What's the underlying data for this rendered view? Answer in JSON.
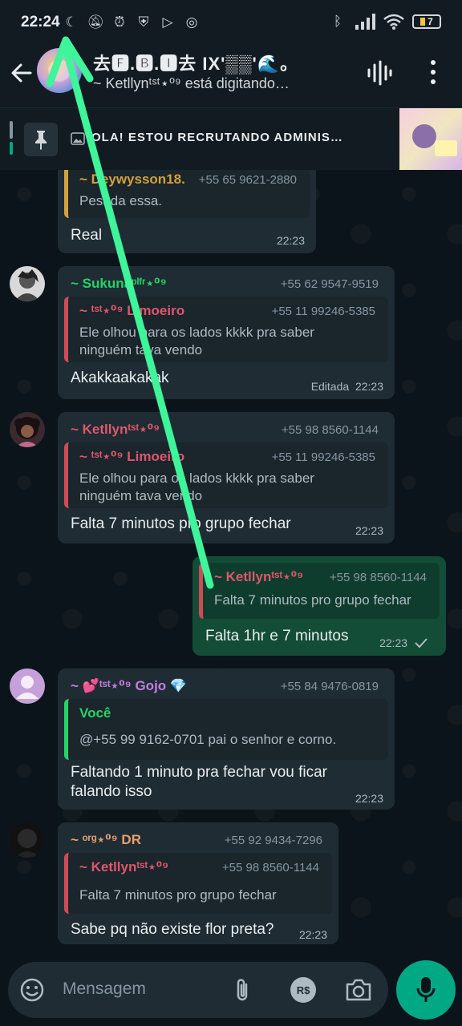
{
  "status_bar": {
    "time": "22:24",
    "battery": "7"
  },
  "header": {
    "title": "去🅵.🅱.🅸去 IX'▒▒'🌊。",
    "subtitle": "~ Ketllynᵗˢᵗ⋆⁰⁹ está digitando…"
  },
  "pinned": {
    "text": "OLA! ESTOU RECRUTANDO ADMINIS…",
    "pin_icon": "pin-icon"
  },
  "messages": [
    {
      "id": "m1",
      "quote_sender": "~ Deywysson18.",
      "quote_phone": "+55 65 9621-2880",
      "quote_text": "Pesada essa.",
      "text": "Real",
      "time": "22:23"
    },
    {
      "id": "m2",
      "sender": "~ Sukunaᵖˡᶠʳ⋆⁰⁹",
      "sender_color": "#25d366",
      "phone": "+55 62 9547-9519",
      "quote_sender": "~ ᵗˢᵗ⋆⁰⁹ Limoeiro",
      "quote_phone": "+55 11 99246-5385",
      "quote_text": "Ele olhou para os lados kkkk pra saber ninguém tava vendo",
      "text": "Akakkaakakak",
      "edited": "Editada",
      "time": "22:23"
    },
    {
      "id": "m3",
      "sender": "~ Ketllynᵗˢᵗ⋆⁰⁹",
      "sender_color": "#e0566b",
      "phone": "+55 98 8560-1144",
      "quote_sender": "~ ᵗˢᵗ⋆⁰⁹ Limoeiro",
      "quote_phone": "+55 11 99246-5385",
      "quote_text": "Ele olhou para os lados kkkk pra saber ninguém tava vendo",
      "text": "Falta 7 minutos pro grupo fechar",
      "time": "22:23"
    },
    {
      "id": "m4",
      "quote_sender": "~ Ketllynᵗˢᵗ⋆⁰⁹",
      "quote_phone": "+55 98 8560-1144",
      "quote_text": "Falta 7 minutos pro grupo fechar",
      "text": "Falta 1hr e 7 minutos",
      "time": "22:23"
    },
    {
      "id": "m5",
      "sender": "~ 💕ᵗˢᵗ⋆⁰⁹ Gojo 💎",
      "sender_color": "#c47fe0",
      "phone": "+55 84 9476-0819",
      "quote_sender": "Você",
      "quote_text": "@+55 99 9162-0701 pai o senhor e corno.",
      "text": "Faltando 1 minuto pra fechar vou ficar falando isso",
      "time": "22:23"
    },
    {
      "id": "m6",
      "sender": "~ ᵒʳᵍ⋆⁰⁹ DR",
      "sender_color": "#e8a06a",
      "phone": "+55 92 9434-7296",
      "quote_sender": "~ Ketllynᵗˢᵗ⋆⁰⁹",
      "quote_phone": "+55 98 8560-1144",
      "quote_text": "Falta 7 minutos pro grupo fechar",
      "text": "Sabe pq não existe flor preta?",
      "time": "22:23"
    }
  ],
  "input": {
    "placeholder": "Mensagem",
    "pay_label": "R$"
  },
  "colors": {
    "accent": "#00a884",
    "annotation_arrow": "#3ef59a"
  }
}
